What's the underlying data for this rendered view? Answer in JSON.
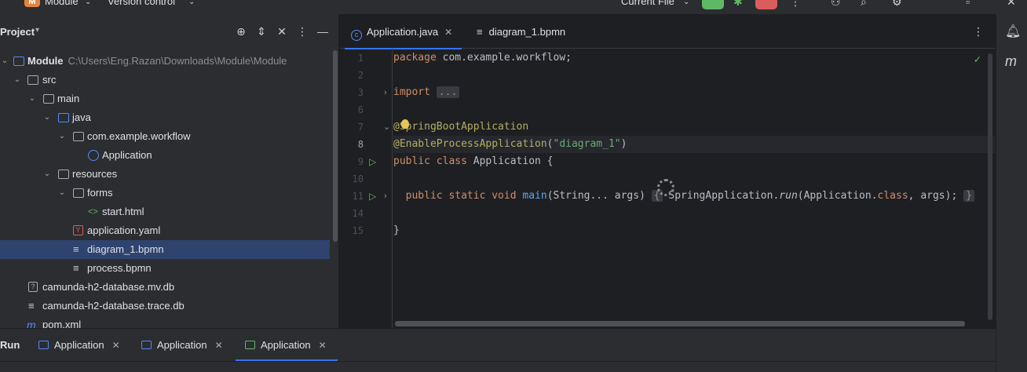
{
  "topbar": {
    "project_badge": "M",
    "project_name": "Module",
    "vcs": "Version control",
    "run_config": "Current File",
    "colors": {
      "run": "#5fb865",
      "stop": "#db5c5c"
    }
  },
  "project_panel": {
    "title": "Project",
    "tree": [
      {
        "label": "Module",
        "path": "C:\\Users\\Eng.Razan\\Downloads\\Module\\Module",
        "depth": 0,
        "expanded": true,
        "icon": "module-folder-icon"
      },
      {
        "label": "src",
        "depth": 1,
        "expanded": true,
        "icon": "folder-icon"
      },
      {
        "label": "main",
        "depth": 2,
        "expanded": true,
        "icon": "folder-icon"
      },
      {
        "label": "java",
        "depth": 3,
        "expanded": true,
        "icon": "source-folder-icon"
      },
      {
        "label": "com.example.workflow",
        "depth": 4,
        "expanded": true,
        "icon": "package-icon"
      },
      {
        "label": "Application",
        "depth": 5,
        "icon": "java-class-icon"
      },
      {
        "label": "resources",
        "depth": 3,
        "expanded": true,
        "icon": "resources-folder-icon"
      },
      {
        "label": "forms",
        "depth": 4,
        "expanded": true,
        "icon": "folder-icon"
      },
      {
        "label": "start.html",
        "depth": 5,
        "icon": "html-file-icon"
      },
      {
        "label": "application.yaml",
        "depth": 4,
        "icon": "yaml-file-icon"
      },
      {
        "label": "diagram_1.bpmn",
        "depth": 4,
        "icon": "text-file-icon",
        "selected": true
      },
      {
        "label": "process.bpmn",
        "depth": 4,
        "icon": "text-file-icon"
      },
      {
        "label": "camunda-h2-database.mv.db",
        "depth": 1,
        "icon": "unknown-file-icon"
      },
      {
        "label": "camunda-h2-database.trace.db",
        "depth": 1,
        "icon": "text-file-icon"
      },
      {
        "label": "pom.xml",
        "depth": 1,
        "icon": "maven-file-icon"
      }
    ]
  },
  "editor": {
    "tabs": [
      {
        "label": "Application.java",
        "active": true
      },
      {
        "label": "diagram_1.bpmn",
        "active": false
      }
    ],
    "line_numbers": [
      "1",
      "2",
      "3",
      "6",
      "7",
      "8",
      "9",
      "10",
      "11",
      "14",
      "15"
    ],
    "current_line": "8",
    "code": {
      "l1_kw": "package",
      "l1_rest": " com.example.workflow;",
      "l3_kw": "import",
      "l3_fold": "...",
      "l7_ann": "@SpringBootApplication",
      "l8_ann": "@EnableProcessApplication",
      "l8_open": "(",
      "l8_str": "\"diagram_1\"",
      "l8_close": ")",
      "l9_kw1": "public",
      "l9_kw2": "class",
      "l9_rest": " Application {",
      "l11_kw": "public static void",
      "l11_fn": "main",
      "l11_args": "(String... args) ",
      "l11_fold_open": "{",
      "l11_call": " SpringApplication.",
      "l11_run": "run",
      "l11_args2": "(Application.",
      "l11_class": "class",
      "l11_end": ", args); ",
      "l11_fold_close": "}",
      "l15": "}"
    }
  },
  "run_panel": {
    "title": "Run",
    "tabs": [
      {
        "label": "Application",
        "active": false
      },
      {
        "label": "Application",
        "active": false
      },
      {
        "label": "Application",
        "active": true
      }
    ]
  }
}
